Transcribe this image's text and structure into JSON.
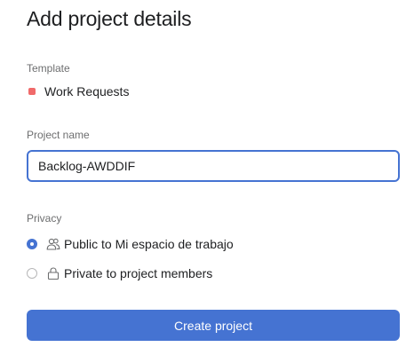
{
  "page": {
    "title": "Add project details"
  },
  "template": {
    "label": "Template",
    "name": "Work Requests",
    "dot_color": "#f06a6a"
  },
  "project_name": {
    "label": "Project name",
    "value": "Backlog-AWDDIF"
  },
  "privacy": {
    "label": "Privacy",
    "options": [
      {
        "label": "Public to Mi espacio de trabajo",
        "icon": "people-icon",
        "selected": true
      },
      {
        "label": "Private to project members",
        "icon": "lock-icon",
        "selected": false
      }
    ]
  },
  "actions": {
    "create_label": "Create project"
  },
  "colors": {
    "accent": "#4573d2"
  }
}
